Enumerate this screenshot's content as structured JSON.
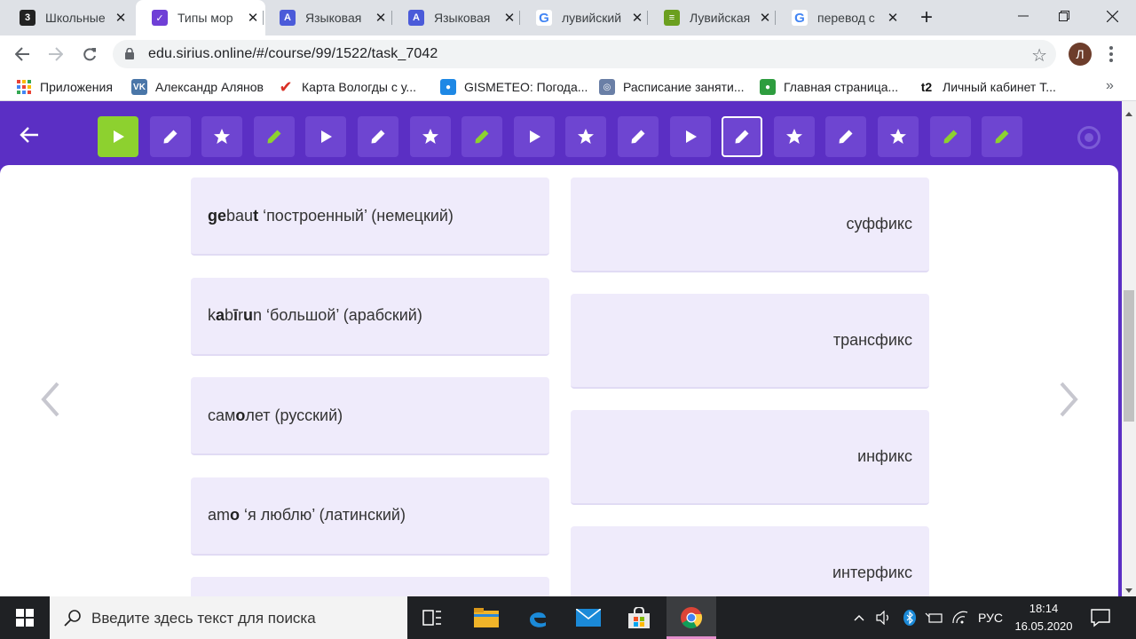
{
  "browser": {
    "tabs": [
      {
        "title": "Школьные",
        "favicon": "school-3-favicon",
        "favicon_text": "3",
        "favicon_color": "#222222"
      },
      {
        "title": "Типы мор",
        "favicon": "sirius-check-favicon",
        "favicon_text": "✓",
        "favicon_color": "#6f3fd6"
      },
      {
        "title": "Языковая",
        "favicon": "translate-favicon",
        "favicon_text": "A",
        "favicon_color": "#4b5bd9"
      },
      {
        "title": "Языковая",
        "favicon": "translate-favicon",
        "favicon_text": "A",
        "favicon_color": "#4b5bd9"
      },
      {
        "title": "лувийский",
        "favicon": "google-favicon",
        "favicon_text": "G",
        "favicon_color": "#4285f4"
      },
      {
        "title": "Лувийская",
        "favicon": "document-favicon",
        "favicon_text": "≡",
        "favicon_color": "#6b9f1f"
      },
      {
        "title": "перевод с",
        "favicon": "google-favicon",
        "favicon_text": "G",
        "favicon_color": "#4285f4"
      }
    ],
    "active_tab": 1,
    "url": "edu.sirius.online/#/course/99/1522/task_7042",
    "profile_initial": "Л",
    "bookmarks": [
      {
        "label": "Приложения",
        "icon": "apps-grid-icon",
        "color": "#ea4335"
      },
      {
        "label": "Александр Алянов",
        "icon": "vk-icon",
        "color": "#4a76a8",
        "text": "VK"
      },
      {
        "label": "Карта Вологды с у...",
        "icon": "checkmark-red-icon",
        "color": "#d93025",
        "text": "✔"
      },
      {
        "label": "GISMETEO: Погода...",
        "icon": "gismeteo-drop-icon",
        "color": "#1e88e5",
        "text": "●"
      },
      {
        "label": "Расписание заняти...",
        "icon": "emblem-icon",
        "color": "#6a7fa6",
        "text": "◎"
      },
      {
        "label": "Главная страница...",
        "icon": "leaf-icon",
        "color": "#2e9d3f",
        "text": "●"
      },
      {
        "label": "Личный кабинет Т...",
        "icon": "t2-icon",
        "color": "#111111",
        "text": "t2"
      }
    ]
  },
  "task_nav": {
    "steps": [
      {
        "type": "play",
        "state": "current"
      },
      {
        "type": "pencil",
        "state": "normal"
      },
      {
        "type": "star",
        "state": "normal"
      },
      {
        "type": "pencil",
        "state": "done"
      },
      {
        "type": "play",
        "state": "normal"
      },
      {
        "type": "pencil",
        "state": "normal"
      },
      {
        "type": "star",
        "state": "normal"
      },
      {
        "type": "pencil",
        "state": "done"
      },
      {
        "type": "play",
        "state": "normal"
      },
      {
        "type": "star",
        "state": "normal"
      },
      {
        "type": "pencil",
        "state": "normal"
      },
      {
        "type": "play",
        "state": "normal"
      },
      {
        "type": "pencil",
        "state": "selected"
      },
      {
        "type": "star",
        "state": "normal"
      },
      {
        "type": "pencil",
        "state": "normal"
      },
      {
        "type": "star",
        "state": "normal"
      },
      {
        "type": "pencil",
        "state": "done"
      },
      {
        "type": "pencil",
        "state": "done"
      }
    ],
    "colors": {
      "current": "#8dd12f",
      "done_icon": "#8dd12f",
      "icon": "#ffffff"
    }
  },
  "examples": [
    {
      "parts": [
        {
          "t": "ge",
          "b": true
        },
        {
          "t": "bau",
          "b": false
        },
        {
          "t": "t",
          "b": true
        },
        {
          "t": " ‘построенный’ (немецкий)",
          "b": false
        }
      ]
    },
    {
      "parts": [
        {
          "t": "k",
          "b": false
        },
        {
          "t": "a",
          "b": true
        },
        {
          "t": "b",
          "b": false
        },
        {
          "t": "ī",
          "b": true
        },
        {
          "t": "r",
          "b": false
        },
        {
          "t": "u",
          "b": true
        },
        {
          "t": "n ‘большой’ (арабский)",
          "b": false
        }
      ]
    },
    {
      "parts": [
        {
          "t": "сам",
          "b": false
        },
        {
          "t": "о",
          "b": true
        },
        {
          "t": "лет (русский)",
          "b": false
        }
      ]
    },
    {
      "parts": [
        {
          "t": "am",
          "b": false
        },
        {
          "t": "o",
          "b": true
        },
        {
          "t": " ‘я люблю’ (латинский)",
          "b": false
        }
      ]
    },
    {
      "parts": []
    }
  ],
  "answers": [
    {
      "label": "суффикс"
    },
    {
      "label": "трансфикс"
    },
    {
      "label": "инфикс"
    },
    {
      "label": "интерфикс"
    }
  ],
  "taskbar": {
    "search_placeholder": "Введите здесь текст для поиска",
    "language": "РУС",
    "time": "18:14",
    "date": "16.05.2020"
  }
}
